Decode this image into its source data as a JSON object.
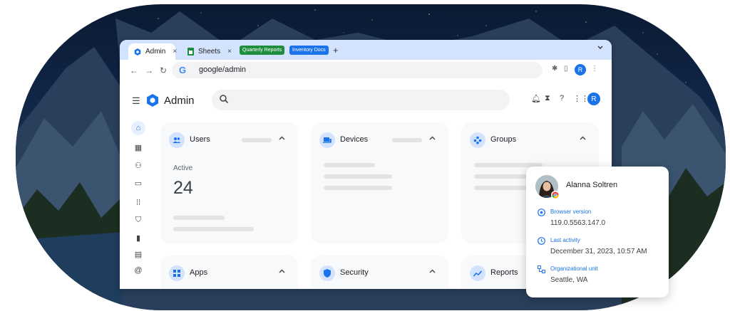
{
  "browser": {
    "tabs": [
      {
        "label": "Admin",
        "close": "×"
      },
      {
        "label": "Sheets",
        "close": "×"
      }
    ],
    "tab_groups": [
      {
        "label": "Quarterly Reports",
        "color": "#1e8e3e"
      },
      {
        "label": "Inventory Docs",
        "color": "#1a73e8"
      }
    ],
    "new_tab": "+",
    "url": "google/admin",
    "profile_initial": "R"
  },
  "app": {
    "title": "Admin",
    "profile_initial": "R"
  },
  "cards": {
    "users": {
      "title": "Users",
      "label": "Active",
      "value": "24"
    },
    "devices": {
      "title": "Devices"
    },
    "groups": {
      "title": "Groups"
    },
    "apps": {
      "title": "Apps"
    },
    "security": {
      "title": "Security"
    },
    "reports": {
      "title": "Reports"
    }
  },
  "popup": {
    "name": "Alanna Soltren",
    "rows": [
      {
        "label": "Browser version",
        "value": "119.0.5563.147.0"
      },
      {
        "label": "Last activity",
        "value": "December 31, 2023, 10:57 AM"
      },
      {
        "label": "Organizational unit",
        "value": "Seattle, WA"
      }
    ]
  },
  "colors": {
    "accent": "#1a73e8",
    "tabstrip": "#d3e3fd",
    "card": "#f8f9fa"
  }
}
